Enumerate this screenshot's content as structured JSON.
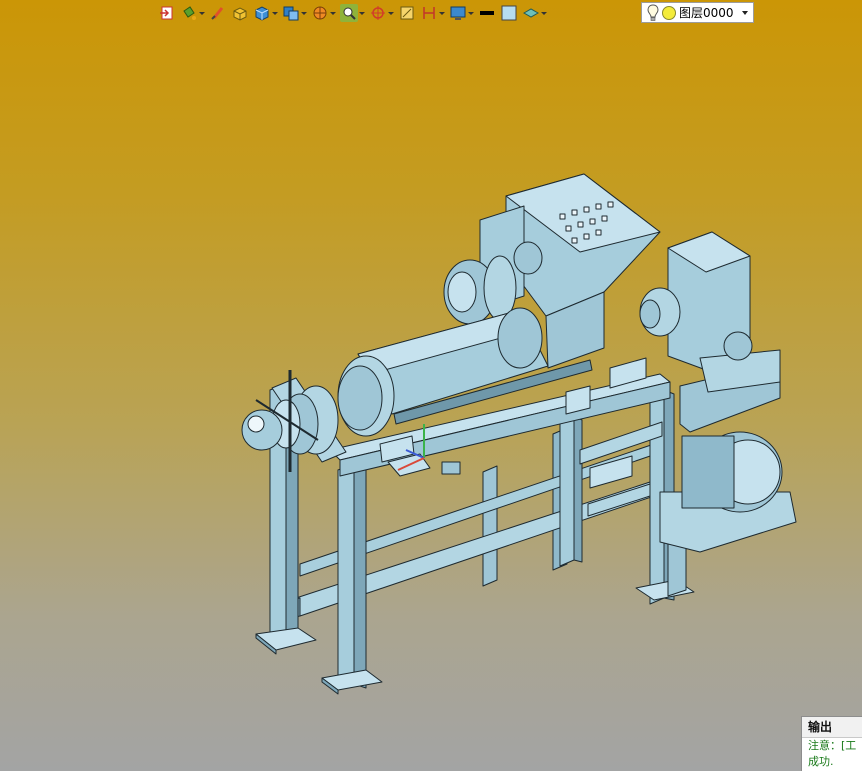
{
  "toolbar": {
    "tools": [
      {
        "icon": "import-icon",
        "dropdown": false
      },
      {
        "icon": "paint-bucket-icon",
        "dropdown": true
      },
      {
        "icon": "brush-icon",
        "dropdown": false
      },
      {
        "icon": "box-solid-icon",
        "dropdown": false
      },
      {
        "icon": "cube-icon",
        "dropdown": true
      },
      {
        "icon": "layers-cube-icon",
        "dropdown": true
      },
      {
        "icon": "render-style-icon",
        "dropdown": true
      },
      {
        "icon": "zoom-view-icon",
        "dropdown": true
      },
      {
        "icon": "target-icon",
        "dropdown": true
      },
      {
        "icon": "dimension-icon",
        "dropdown": false
      },
      {
        "icon": "height-icon",
        "dropdown": true
      },
      {
        "icon": "display-icon",
        "dropdown": true
      },
      {
        "icon": "line-weight-icon",
        "dropdown": false
      },
      {
        "icon": "color-swatch-icon",
        "dropdown": false
      },
      {
        "icon": "layer-plane-icon",
        "dropdown": true
      }
    ],
    "layer_name": "图层0000",
    "layer_color": "#f4ec3a"
  },
  "output": {
    "title": "输出",
    "note_line": "注意：[工",
    "success_line": "成功."
  },
  "colors": {
    "model": "#9fc6d6",
    "model_dark": "#6f98aa",
    "model_light": "#c6e2ee",
    "outline": "#1e2a30",
    "bg_top": "#cb9606",
    "bg_bottom": "#a3a4a4"
  }
}
